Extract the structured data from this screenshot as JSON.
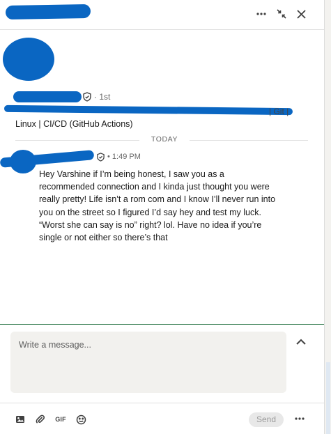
{
  "header": {
    "more_icon": "ellipsis-icon",
    "collapse_icon": "minimize-arrows-icon",
    "close_icon": "close-icon"
  },
  "profile": {
    "degree": "· 1st",
    "headline_tail": "| Git |",
    "headline_line2": "Linux | CI/CD (GitHub Actions)"
  },
  "divider": {
    "label": "TODAY"
  },
  "message": {
    "time": "• 1:49 PM",
    "text": "Hey Varshine if I’m being honest, I saw you as a recommended connection and I kinda just thought you were really pretty! Life isn’t a rom com and I know I’ll never run into you on the street so I figured I’d say hey and test my luck. “Worst she can say is no” right? lol. Have no idea if you’re single or not either so there’s that"
  },
  "compose": {
    "placeholder": "Write a message...",
    "gif_label": "GIF",
    "send_label": "Send"
  },
  "colors": {
    "redaction": "#0a66c2",
    "compose_border": "#1d6d3b"
  }
}
